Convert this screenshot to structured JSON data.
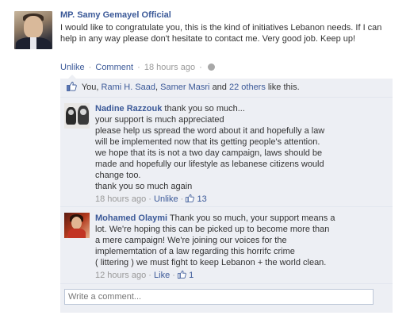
{
  "post": {
    "author": "MP. Samy Gemayel Official",
    "text": "I would like to congratulate you, this is the kind of initiatives Lebanon needs. If I can help in any way please don't hesitate to contact me. Very good job. Keep up!",
    "actions": {
      "unlike": "Unlike",
      "sep1": "·",
      "comment": "Comment",
      "sep2": "·",
      "time": "18 hours ago",
      "sep3": "·"
    }
  },
  "likes": {
    "you": "You,",
    "person1": "Rami H. Saad",
    "comma": ",",
    "person2": "Samer Masri",
    "and": "and",
    "others": "22 others",
    "suffix": "like this."
  },
  "comments": [
    {
      "name": "Nadine Razzouk",
      "lines": [
        "thank you so much...",
        "your support is much appreciated",
        "please help us spread the word about it and hopefully a law",
        "will be implemented now that its getting people's attention.",
        "we hope that its is not a two day campaign, laws should be",
        "made and hopefully our lifestyle as lebanese citizens would",
        "change too.",
        "thank you so much again"
      ],
      "time": "18 hours ago",
      "sep1": "·",
      "action": "Unlike",
      "sep2": "·",
      "like_count": "13"
    },
    {
      "name": "Mohamed Olaymi",
      "first_line": "Thank you so much, your support means a",
      "lines": [
        "lot. We're hoping this can be picked up to become more than",
        "a mere campaign! We're joining our voices for the",
        "implememtation of a law regarding this horrifc crime",
        "( littering ) we must fight to keep Lebanon + the world clean."
      ],
      "time": "12 hours ago",
      "sep1": "·",
      "action": "Like",
      "sep2": "·",
      "like_count": "1"
    }
  ],
  "composer": {
    "placeholder": "Write a comment..."
  },
  "colors": {
    "link": "#3b5998",
    "ufi_bg": "#edeff4",
    "meta": "#999999"
  }
}
